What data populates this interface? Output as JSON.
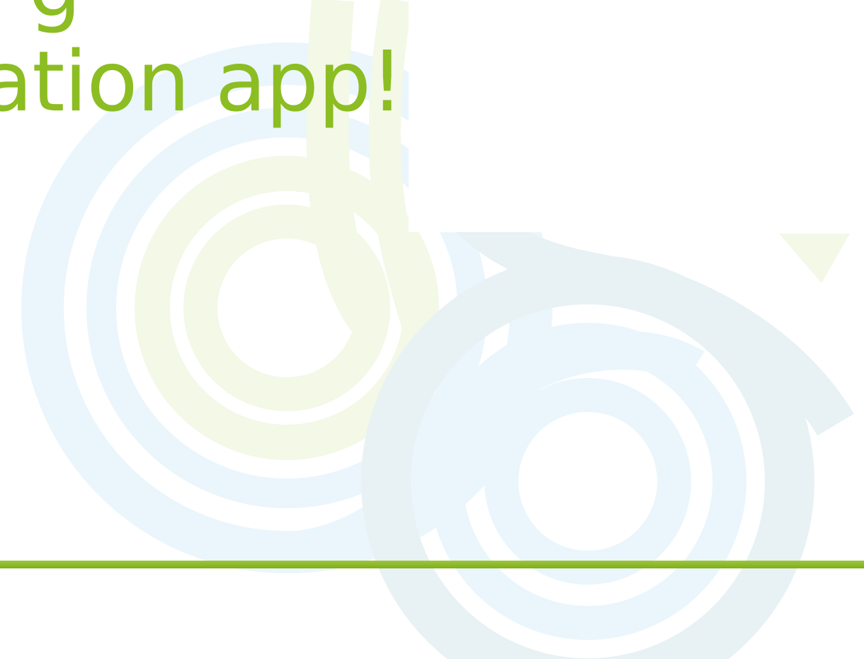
{
  "headline": {
    "top_line": "g",
    "line": "ation app!"
  },
  "colors": {
    "headline": "#8cbd22",
    "divider": "#86b624",
    "pattern_blue": "#e9f5fb",
    "pattern_green": "#f3f8e6",
    "pattern_slate": "#e8f1f3"
  },
  "icons": {
    "background": "abstract-swirl-pattern"
  }
}
